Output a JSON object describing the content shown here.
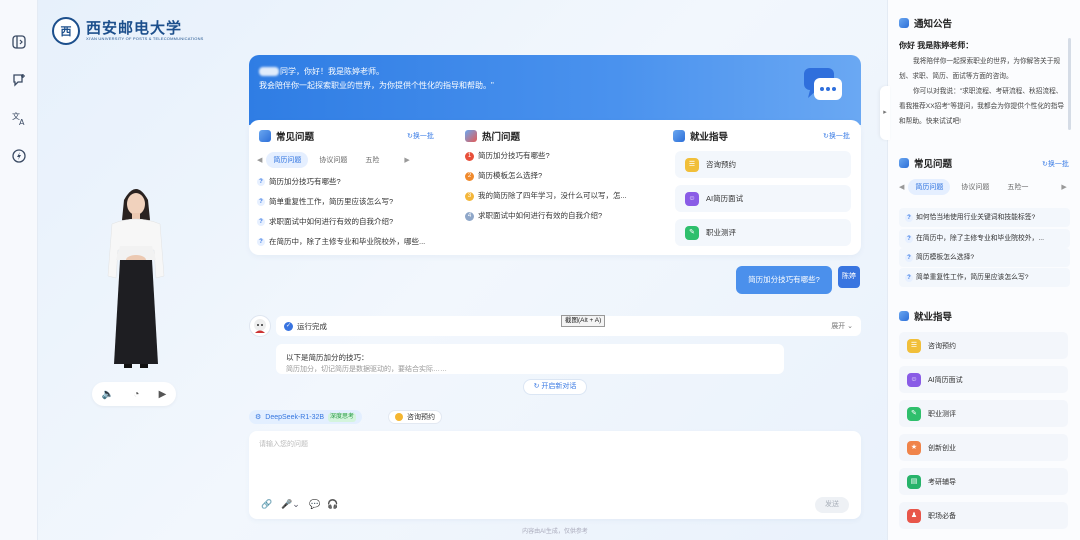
{
  "logo": {
    "seal": "西",
    "name_cn": "西安邮电大学",
    "name_en": "XI'AN UNIVERSITY OF POSTS & TELECOMMUNICATIONS"
  },
  "rail": {
    "icons": [
      "panel-toggle-icon",
      "new-chat-icon",
      "translate-icon",
      "lightning-icon"
    ]
  },
  "avatar_controls": {
    "volume": "🔈",
    "speed": "◔",
    "play": "▶"
  },
  "banner": {
    "line1": "同学，你好！我是陈婷老师。",
    "line2": "我会陪伴你一起探索职业的世界，为你提供个性化的指导和帮助。\""
  },
  "faq": {
    "title": "常见问题",
    "refresh": "↻换一批",
    "tabs": [
      "简历问题",
      "协议问题",
      "五险"
    ],
    "active_tab": 0,
    "items": [
      "简历加分技巧有哪些?",
      "简单重复性工作，简历里应该怎么写?",
      "求职面试中如何进行有效的自我介绍?",
      "在简历中，除了主修专业和毕业院校外，哪些..."
    ]
  },
  "hot": {
    "title": "热门问题",
    "items": [
      {
        "rank": "1",
        "text": "简历加分技巧有哪些?",
        "color": "#e8503a"
      },
      {
        "rank": "2",
        "text": "简历模板怎么选择?",
        "color": "#f08a2c"
      },
      {
        "rank": "3",
        "text": "我的简历除了四年学习，没什么可以写，怎...",
        "color": "#f4b63a"
      },
      {
        "rank": "4",
        "text": "求职面试中如何进行有效的自我介绍?",
        "color": "#8fa7c9"
      }
    ]
  },
  "guide": {
    "title": "就业指导",
    "refresh": "↻换一批",
    "items": [
      {
        "label": "咨询预约",
        "color": "#f1bf3a",
        "icon": "☰"
      },
      {
        "label": "AI简历面试",
        "color": "#8a5ce6",
        "icon": "☺"
      },
      {
        "label": "职业测评",
        "color": "#2fbf6c",
        "icon": "✎"
      }
    ]
  },
  "user_message": {
    "text": "简历加分技巧有哪些?",
    "avatar": "陈婷"
  },
  "answer": {
    "status": "运行完成",
    "collapse": "展开 ⌄",
    "line1": "以下是简历加分的技巧：",
    "line2": "简历加分，切记简历是数据驱动的，要结合实际……"
  },
  "tooltip": "截图(Alt + A)",
  "new_chat": "↻ 开启新对话",
  "model": {
    "name": "DeepSeek-R1-32B",
    "badge": "深度思考"
  },
  "consult_chip": "咨询预约",
  "input": {
    "placeholder": "请输入您的问题",
    "send": "发送"
  },
  "footer": "内容由AI生成，仅供参考",
  "right": {
    "notice": {
      "title": "通知公告",
      "subtitle": "你好 我是陈婷老师：",
      "para1": "我将陪伴你一起探索职业的世界，为你解答关于规划、求职、简历、面试等方面的咨询。",
      "para2": "你可以对我说：\"求职流程、考研流程、秋招流程、看我推荐XX招考\"等提问，我都会为你提供个性化的指导和帮助。快来试试吧!"
    },
    "faq": {
      "title": "常见问题",
      "refresh": "↻换一批",
      "tabs": [
        "简历问题",
        "协议问题",
        "五险一"
      ],
      "active_tab": 0,
      "items": [
        "如何恰当地使用行业关键词和技能标签?",
        "在简历中，除了主修专业和毕业院校外，...",
        "简历模板怎么选择?",
        "简单重复性工作，简历里应该怎么写?"
      ]
    },
    "guide": {
      "title": "就业指导",
      "items": [
        {
          "label": "咨询预约",
          "color": "#f1bf3a",
          "icon": "☰"
        },
        {
          "label": "AI简历面试",
          "color": "#8a5ce6",
          "icon": "☺"
        },
        {
          "label": "职业测评",
          "color": "#2fbf6c",
          "icon": "✎"
        },
        {
          "label": "创新创业",
          "color": "#f0844a",
          "icon": "★"
        },
        {
          "label": "考研辅导",
          "color": "#27b36a",
          "icon": "▤"
        },
        {
          "label": "职场必备",
          "color": "#e8564a",
          "icon": "♟"
        }
      ]
    }
  }
}
